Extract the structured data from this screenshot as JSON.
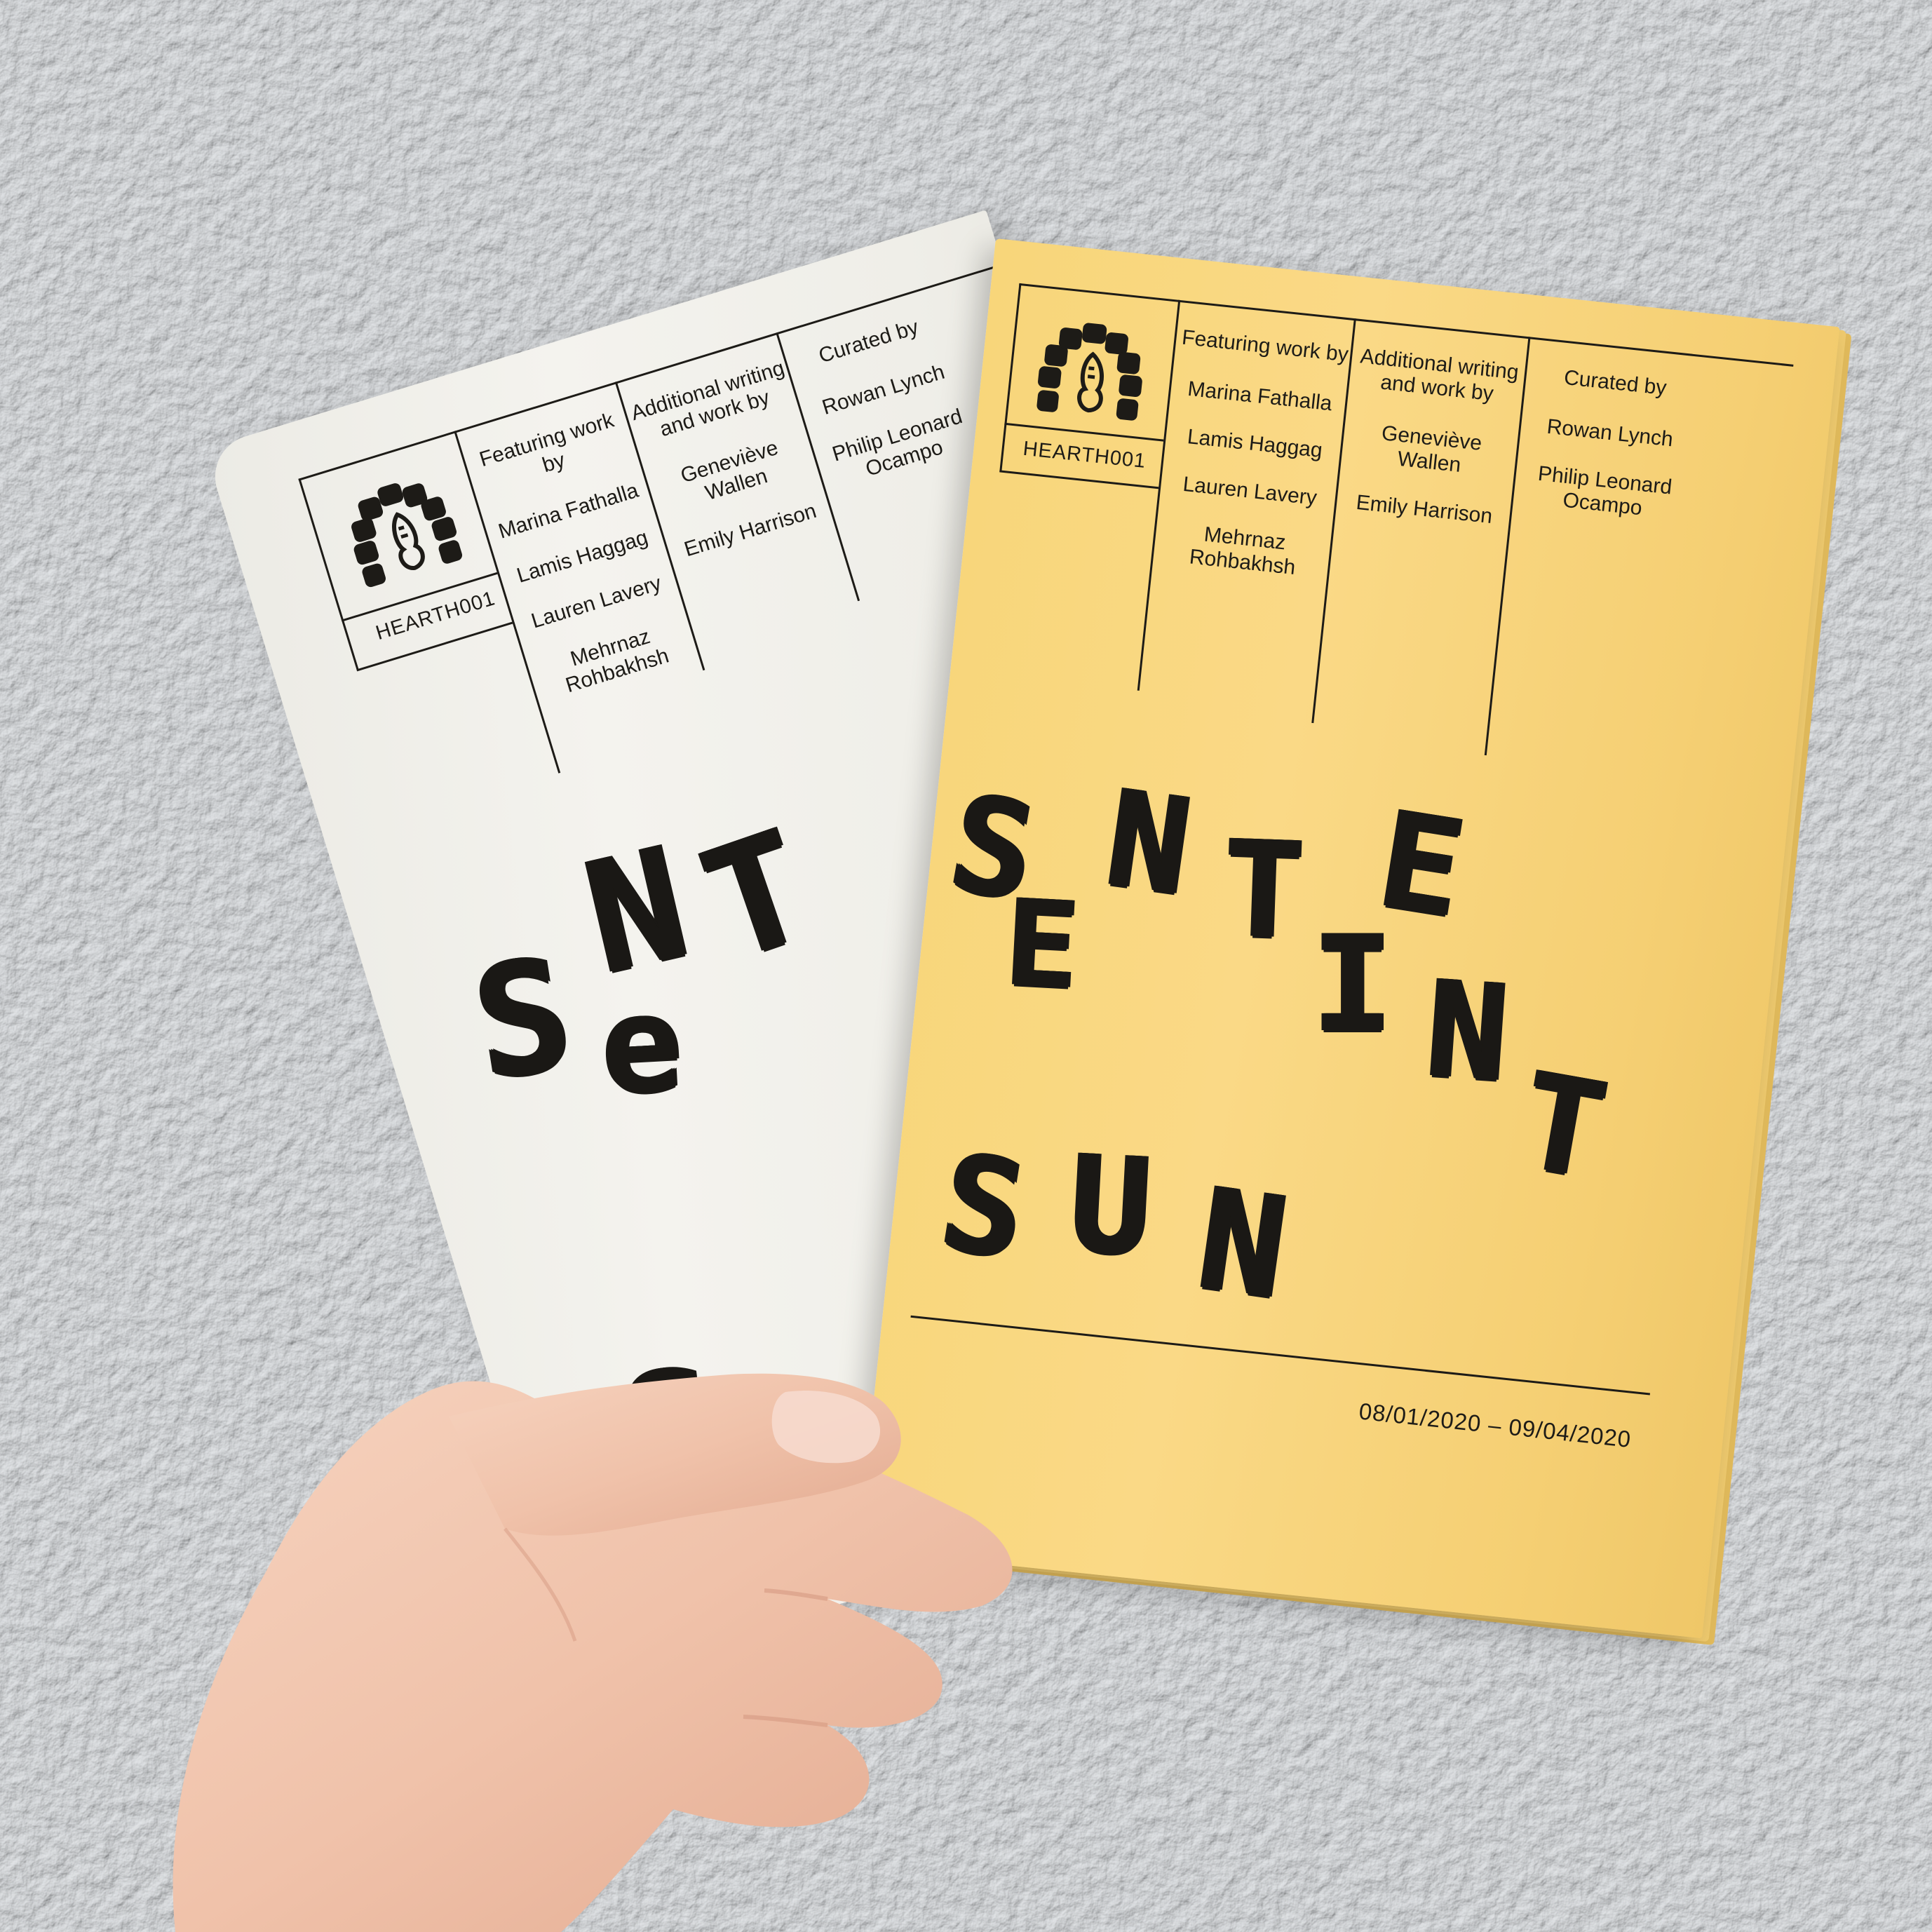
{
  "scene": {
    "description_colors": {
      "wall": "#d9dadc",
      "white_cover": "#f1f0ea",
      "yellow_cover": "#f8d67a",
      "ink": "#1d1b17",
      "skin": "#f2c7b0"
    }
  },
  "white_booklet": {
    "code": "HEARTH001",
    "columns": [
      {
        "heading": "Featuring work by",
        "names": [
          "Marina Fathalla",
          "Lamis Haggag",
          "Lauren Lavery",
          "Mehrnaz Rohbakhsh"
        ]
      },
      {
        "heading": "Additional writing and work by",
        "names": [
          "Geneviève Wallen",
          "Emily Harrison"
        ]
      },
      {
        "heading": "Curated by",
        "names": [
          "Rowan Lynch",
          "Philip Leonard Ocampo"
        ]
      }
    ],
    "title_letters": [
      "S",
      "e",
      "N",
      "T"
    ]
  },
  "yellow_booklet": {
    "code": "HEARTH001",
    "columns": [
      {
        "heading": "Featuring work by",
        "names": [
          "Marina Fathalla",
          "Lamis Haggag",
          "Lauren Lavery",
          "Mehrnaz Rohbakhsh"
        ]
      },
      {
        "heading": "Additional writing and work by",
        "names": [
          "Geneviève Wallen",
          "Emily Harrison"
        ]
      },
      {
        "heading": "Curated by",
        "names": [
          "Rowan Lynch",
          "Philip Leonard Ocampo"
        ]
      }
    ],
    "title_line1": [
      "S",
      "E",
      "N",
      "T",
      "I",
      "E",
      "N",
      "T"
    ],
    "title_line2": [
      "S",
      "U",
      "N"
    ],
    "dates": "08/01/2020 – 09/04/2020"
  }
}
